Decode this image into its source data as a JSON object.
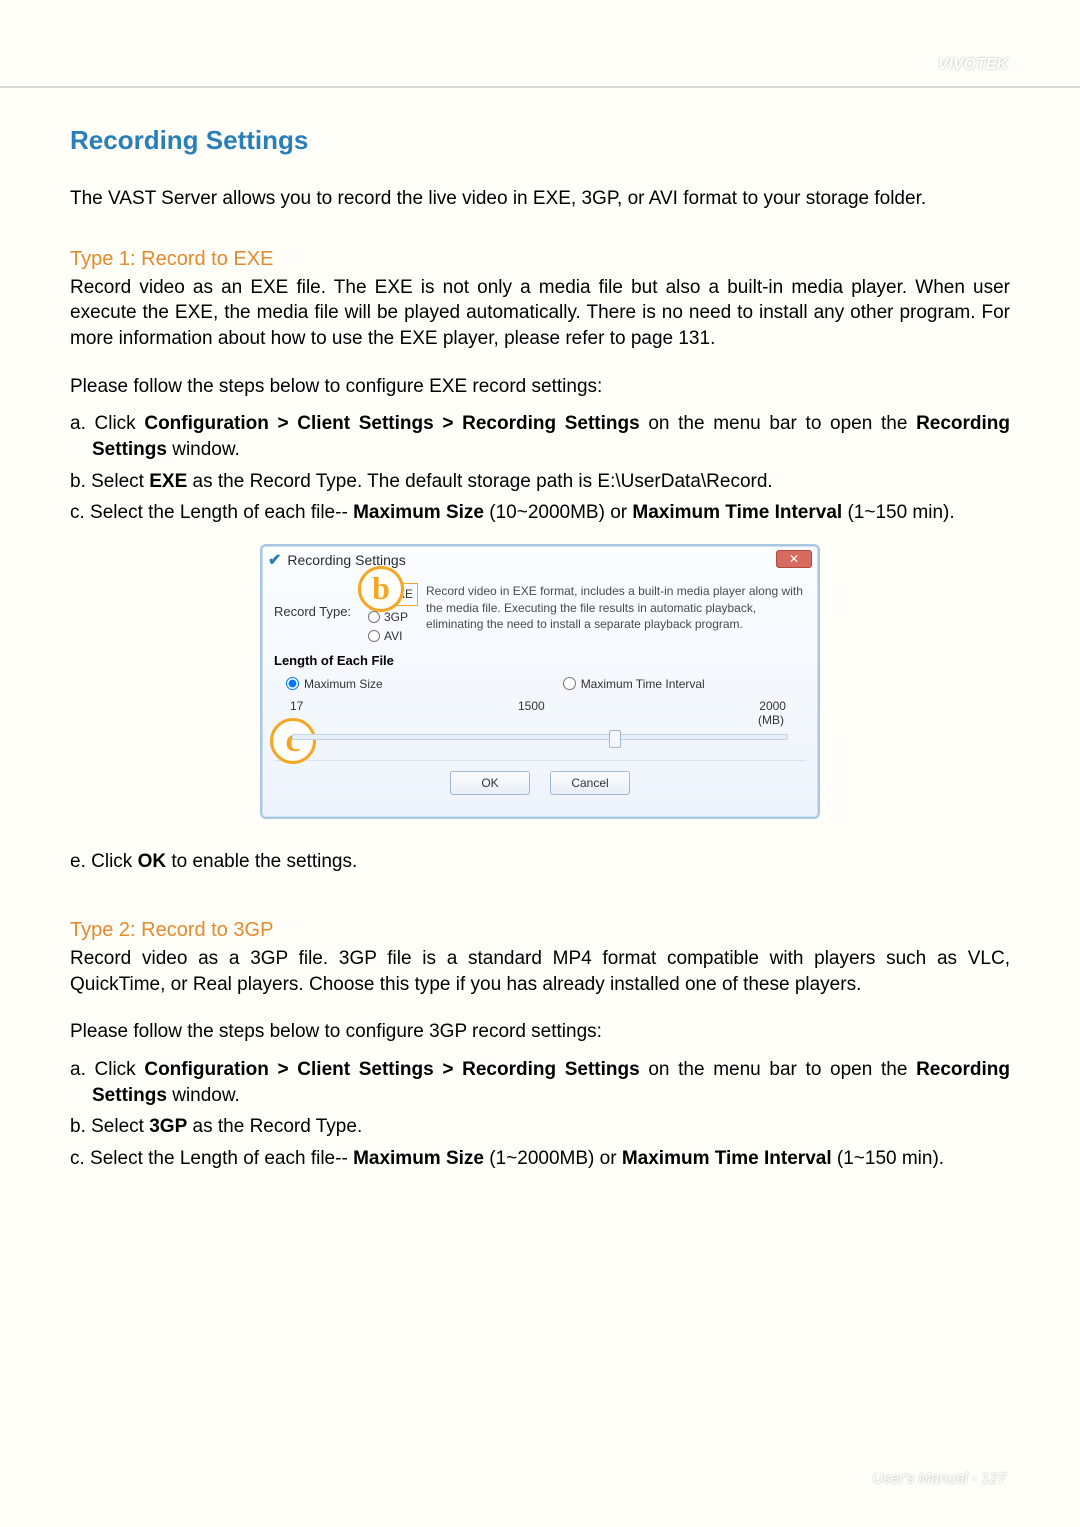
{
  "brand": "VIVOTEK",
  "title": "Recording Settings",
  "intro": "The VAST Server allows you to record the live video in EXE, 3GP, or AVI format to your storage folder.",
  "type1": {
    "heading": "Type 1: Record to EXE",
    "desc": "Record video as an EXE file. The EXE is not only a media file but also a built-in media player. When user execute the EXE, the media file will be played automatically. There is no need to install any other program. For more information about how to use the EXE player, please refer to page 131.",
    "lead": "Please follow the steps below to configure EXE record settings:",
    "a_pre": "a. Click ",
    "a_bold1": "Configuration > Client Settings > Recording Settings",
    "a_mid": " on the menu bar to open the ",
    "a_bold2": "Recording Settings",
    "a_post": " window.",
    "b_pre": "b. Select ",
    "b_bold": "EXE",
    "b_post": " as the Record Type. The default storage path is E:\\UserData\\Record.",
    "c_pre": "c. Select the Length of each file-- ",
    "c_bold1": "Maximum Size",
    "c_mid": " (10~2000MB) or ",
    "c_bold2": "Maximum Time Interval",
    "c_post": " (1~150 min).",
    "e_pre": "e. Click ",
    "e_bold": "OK",
    "e_post": " to enable the settings."
  },
  "dialog": {
    "title": "Recording Settings",
    "close": "✕",
    "record_type_label": "Record Type:",
    "opt_exe": "EXE",
    "opt_3gp": "3GP",
    "opt_avi": "AVI",
    "desc": "Record video in EXE format, includes a built-in media player along with the media file. Executing the file results in automatic playback, eliminating the need to install a separate playback program.",
    "length_head": "Length of Each File",
    "max_size": "Maximum Size",
    "max_time": "Maximum Time Interval",
    "scale_min": "17",
    "scale_mid": "1500",
    "scale_max": "2000",
    "unit": "(MB)",
    "ok": "OK",
    "cancel": "Cancel"
  },
  "annot_b": "b",
  "annot_c": "c",
  "type2": {
    "heading": "Type 2: Record to 3GP",
    "desc": "Record video as a 3GP file. 3GP file is a standard MP4 format compatible with players such as VLC, QuickTime, or Real players. Choose this type if you has already installed one of these players.",
    "lead": "Please follow the steps below to configure 3GP record settings:",
    "a_pre": "a. Click ",
    "a_bold1": "Configuration > Client Settings > Recording Settings",
    "a_mid": " on the menu bar to open the ",
    "a_bold2": "Recording Settings",
    "a_post": " window.",
    "b_pre": "b. Select ",
    "b_bold": "3GP",
    "b_post": " as the Record Type.",
    "c_pre": "c. Select the Length of each file-- ",
    "c_bold1": "Maximum Size",
    "c_mid": " (1~2000MB) or ",
    "c_bold2": "Maximum Time Interval",
    "c_post": " (1~150 min)."
  },
  "footer": "User's Manual - 127"
}
